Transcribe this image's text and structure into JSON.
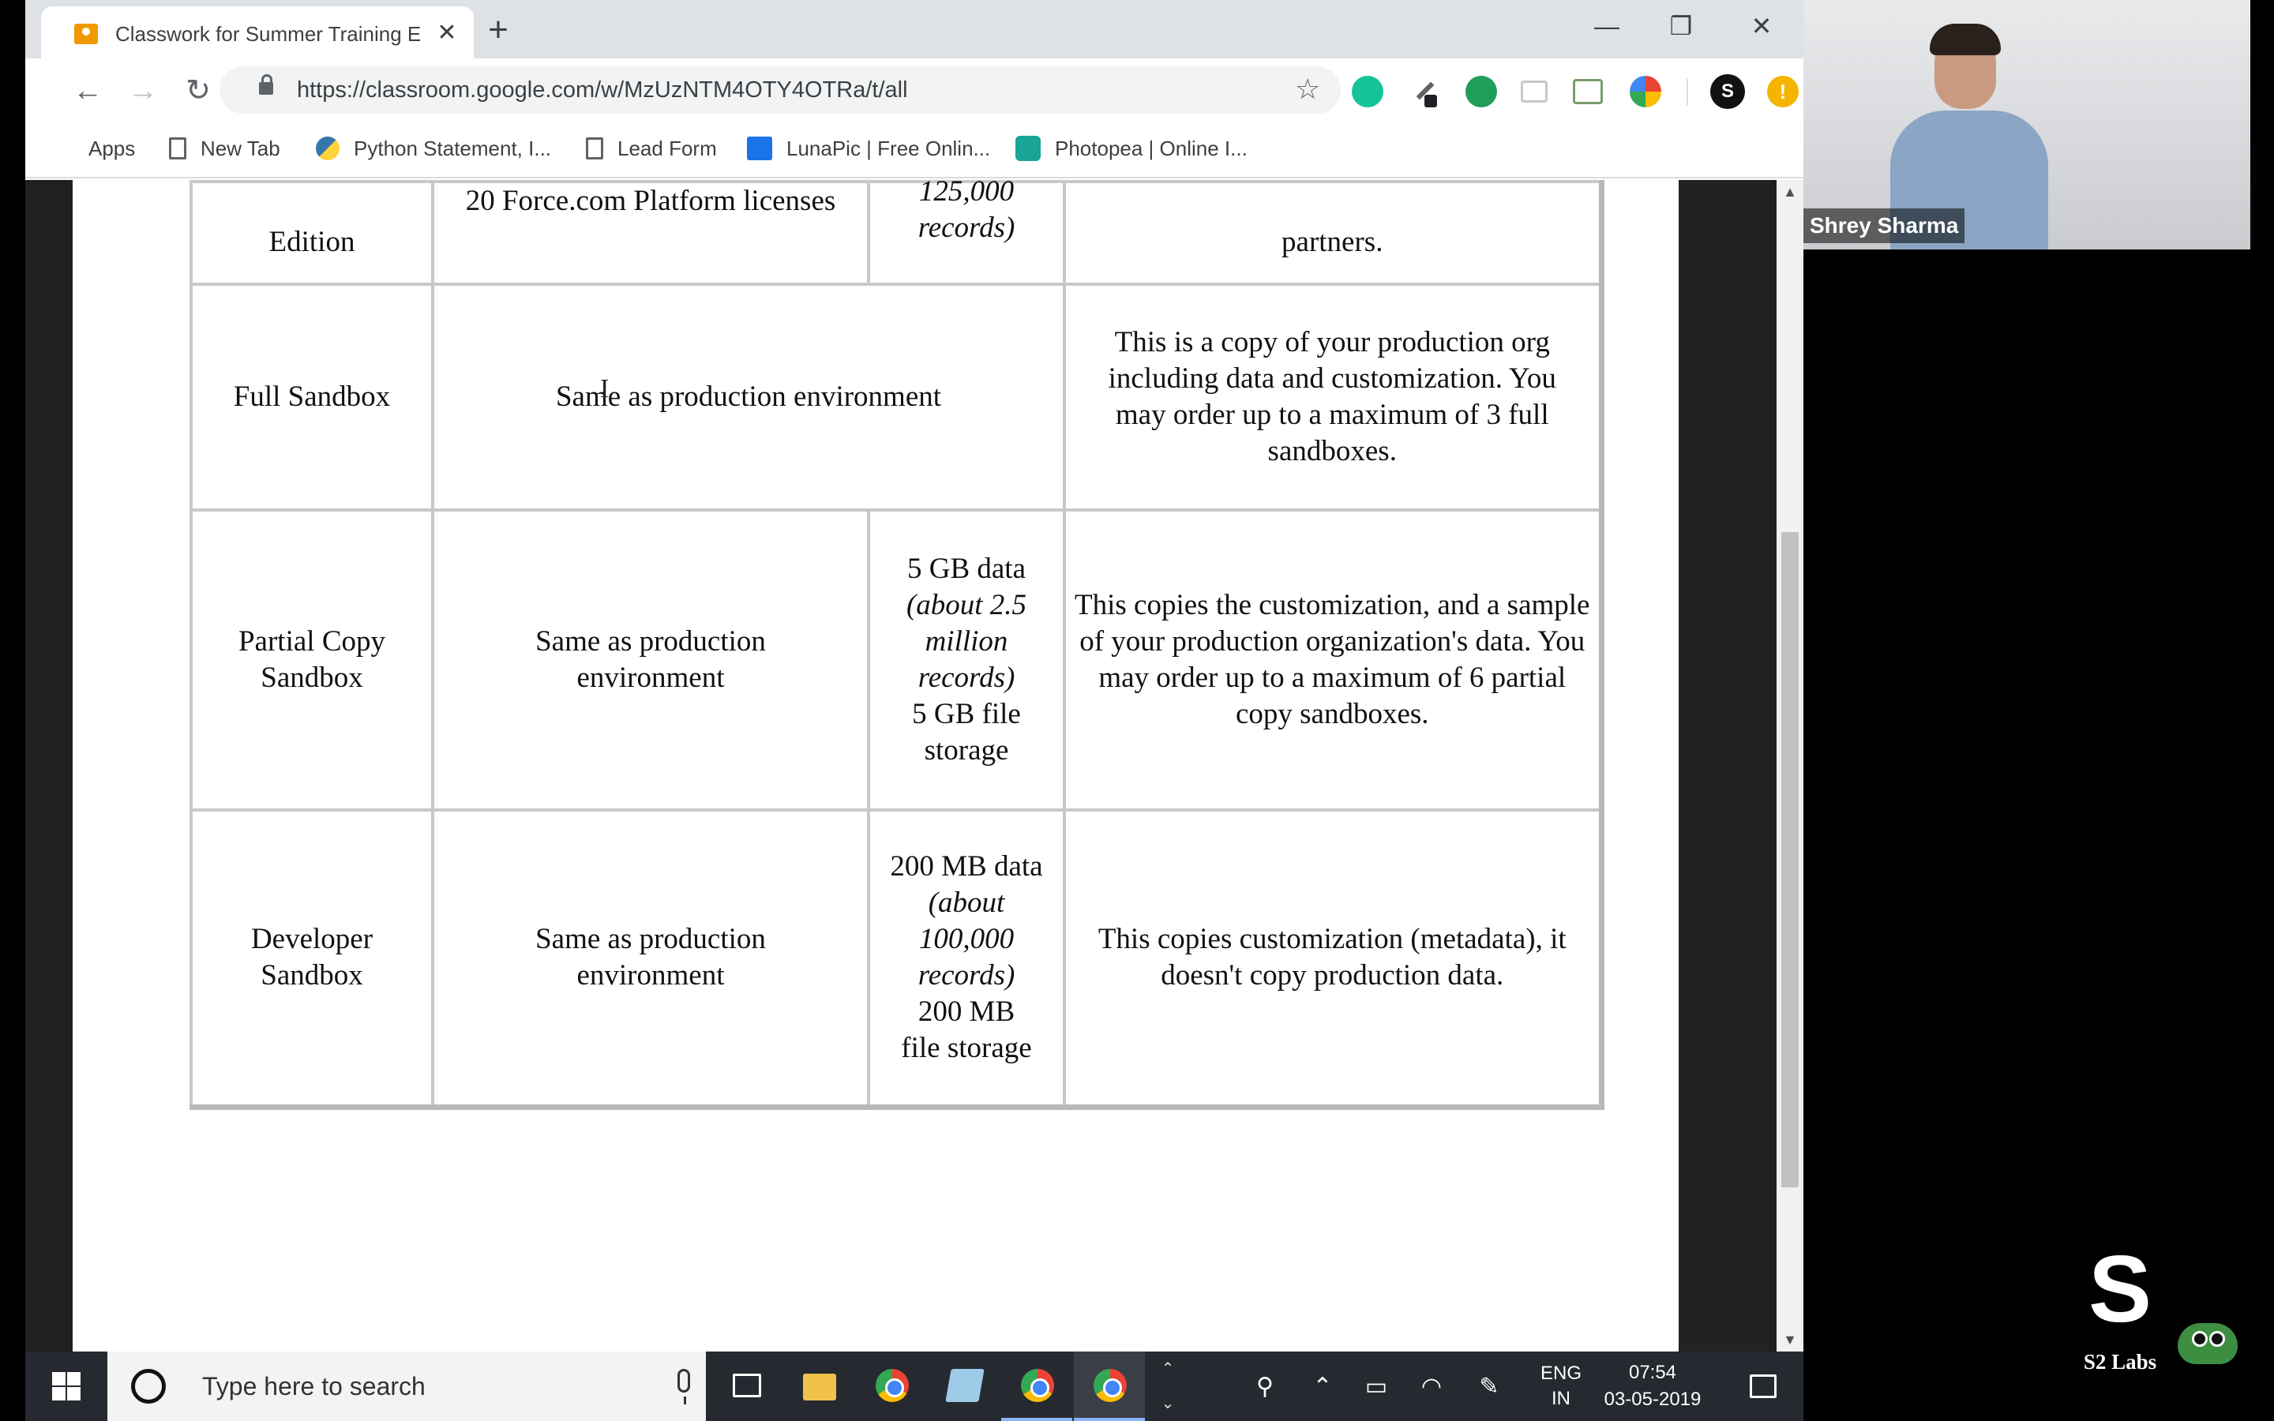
{
  "browser": {
    "tab_title": "Classwork for Summer Training E",
    "url": "https://classroom.google.com/w/MzUzNTM4OTY4OTRa/t/all",
    "bookmarks": [
      {
        "label": "Apps",
        "icon": "apps-grid-icon"
      },
      {
        "label": "New Tab",
        "icon": "page-icon"
      },
      {
        "label": "Python Statement, I...",
        "icon": "python-icon"
      },
      {
        "label": "Lead Form",
        "icon": "page-icon"
      },
      {
        "label": "LunaPic | Free Onlin...",
        "icon": "lunapic-icon"
      },
      {
        "label": "Photopea | Online I...",
        "icon": "photopea-icon"
      }
    ]
  },
  "document": {
    "rows": [
      {
        "c1": "Edition",
        "c2": "20 Force.com Platform licenses",
        "c3": "125,000",
        "c3b": "records)",
        "c4": "partners."
      },
      {
        "c1": "Full Sandbox",
        "c2": "Same as production environment",
        "c4": "This is a copy of your production org including data and customization. You may order up to a maximum of 3 full sandboxes."
      },
      {
        "c1": "Partial Copy Sandbox",
        "c2": "Same as production environment",
        "c3a": "5 GB data",
        "c3b": "(about 2.5 million records)",
        "c3c": "5 GB file storage",
        "c4": "This copies the customization, and a sample of your production organization's data. You may order up to a maximum of 6 partial copy sandboxes."
      },
      {
        "c1": "Developer Sandbox",
        "c2": "Same as production environment",
        "c3a": "200 MB data",
        "c3b": "(about 100,000 records)",
        "c3c": "200 MB file storage",
        "c4": "This copies customization (metadata), it doesn't copy production data."
      }
    ]
  },
  "taskbar": {
    "search_placeholder": "Type here to search",
    "lang_top": "ENG",
    "lang_bottom": "IN",
    "time": "07:54",
    "date": "03-05-2019"
  },
  "webcam": {
    "presenter_name": "Shrey Sharma"
  },
  "brand": {
    "logo_text": "S2 Labs"
  },
  "colors": {
    "tab_bar": "#dee1e6",
    "taskbar": "#262a30",
    "accent": "#1a73e8"
  }
}
